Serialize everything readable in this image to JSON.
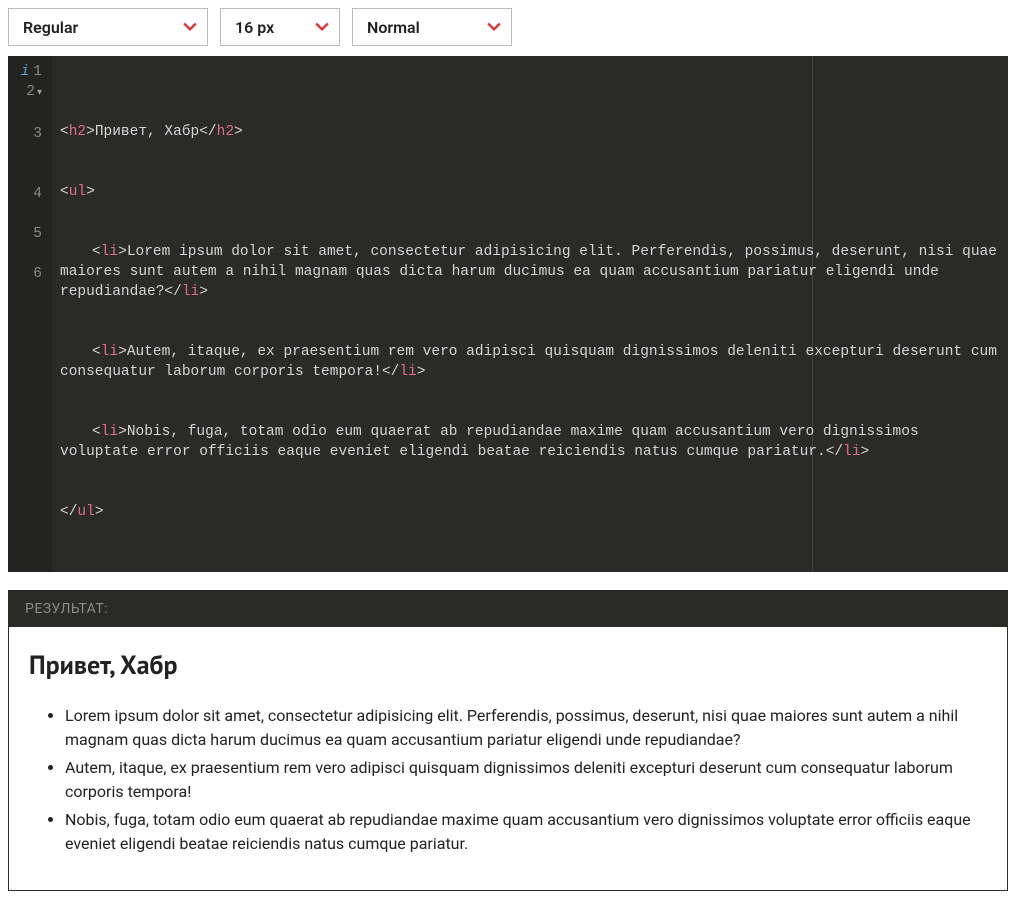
{
  "toolbar": {
    "weight": "Regular",
    "size": "16 px",
    "style": "Normal"
  },
  "editor": {
    "gutter": [
      "1",
      "2",
      "3",
      "4",
      "5",
      "6"
    ],
    "heading_text": "Привет, Хабр",
    "items": [
      "Lorem ipsum dolor sit amet, consectetur adipisicing elit. Perferendis, possimus, deserunt, nisi quae maiores sunt autem a nihil magnam quas dicta harum ducimus ea quam accusantium pariatur eligendi unde repudiandae?",
      "Autem, itaque, ex praesentium rem vero adipisci quisquam dignissimos deleniti excepturi deserunt cum consequatur laborum corporis tempora!",
      "Nobis, fuga, totam odio eum quaerat ab repudiandae maxime quam accusantium vero dignissimos voluptate error officiis eaque eveniet eligendi beatae reiciendis natus cumque pariatur."
    ]
  },
  "result": {
    "label": "РЕЗУЛЬТАТ:",
    "heading": "Привет, Хабр",
    "items": [
      "Lorem ipsum dolor sit amet, consectetur adipisicing elit. Perferendis, possimus, deserunt, nisi quae maiores sunt autem a nihil magnam quas dicta harum ducimus ea quam accusantium pariatur eligendi unde repudiandae?",
      "Autem, itaque, ex praesentium rem vero adipisci quisquam dignissimos deleniti excepturi deserunt cum consequatur laborum corporis tempora!",
      "Nobis, fuga, totam odio eum quaerat ab repudiandae maxime quam accusantium vero dignissimos voluptate error officiis eaque eveniet eligendi beatae reiciendis natus cumque pariatur."
    ]
  }
}
